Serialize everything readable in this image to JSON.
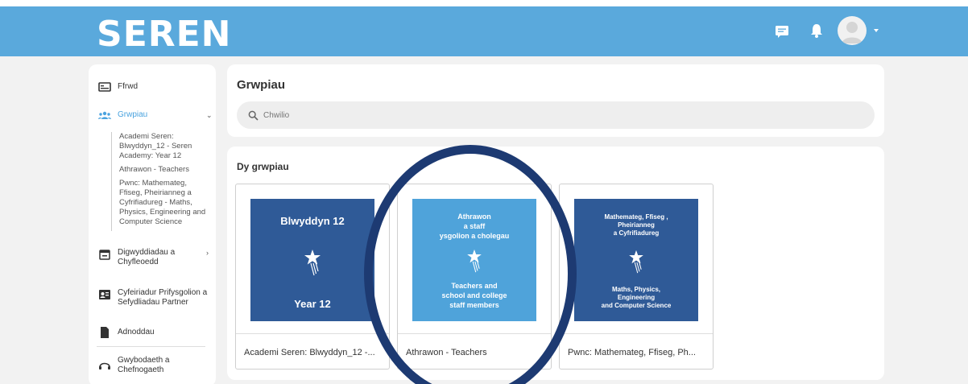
{
  "brand": {
    "logo_text": "SEREN",
    "color": "#5aa9dc"
  },
  "header": {
    "icons": [
      "message-icon",
      "bell-icon",
      "avatar",
      "caret-down-icon"
    ]
  },
  "sidebar": {
    "items": [
      {
        "label": "Ffrwd",
        "icon": "feed-icon"
      },
      {
        "label": "Grwpiau",
        "icon": "groups-icon",
        "active": true
      },
      {
        "label": "Digwyddiadau a Chyfleoedd",
        "icon": "calendar-icon"
      },
      {
        "label": "Cyfeiriadur Prifysgolion a Sefydliadau Partner",
        "icon": "directory-icon"
      },
      {
        "label": "Adnoddau",
        "icon": "file-icon"
      },
      {
        "label": "Gwybodaeth a Chefnogaeth",
        "icon": "support-icon"
      }
    ],
    "group_sublist": [
      "Academi Seren: Blwyddyn_12 - Seren Academy: Year 12",
      "Athrawon - Teachers",
      "Pwnc: Mathemateg, Ffiseg, Pheirianneg a Cyfrifiadureg - Maths, Physics, Engineering and Computer Science"
    ]
  },
  "groups_panel": {
    "title": "Grwpiau",
    "search_placeholder": "Chwilio"
  },
  "my_groups": {
    "title": "Dy grwpiau",
    "cards": [
      {
        "thumb_top": "Blwyddyn 12",
        "thumb_bottom": "Year 12",
        "thumb_color": "#2f5a97",
        "label": "Academi Seren: Blwyddyn_12 -..."
      },
      {
        "thumb_top": "Athrawon\na staff\nysgolion a cholegau",
        "thumb_bottom": "Teachers and\nschool and college\nstaff members",
        "thumb_color": "#4fa3da",
        "label": "Athrawon - Teachers"
      },
      {
        "thumb_top": "Mathemateg, Ffiseg ,\nPheirianneg\na Cyfrifiadureg",
        "thumb_bottom": "Maths, Physics,\nEngineering\nand Computer Science",
        "thumb_color": "#2f5a97",
        "label": "Pwnc: Mathemateg, Ffiseg, Ph..."
      }
    ]
  },
  "annotation": {
    "color": "#1d3a72"
  }
}
